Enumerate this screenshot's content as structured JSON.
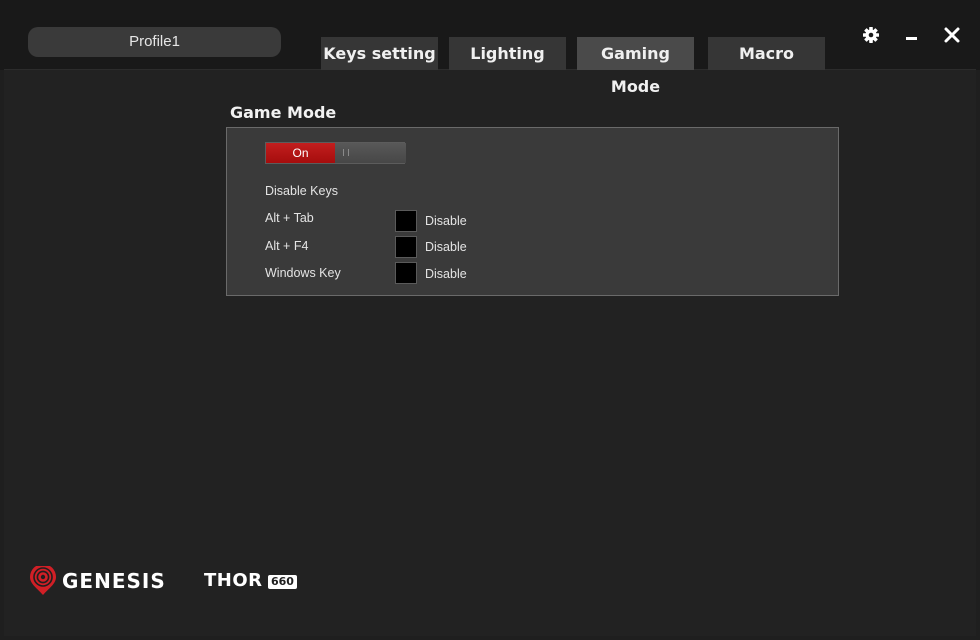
{
  "header": {
    "profile_label": "Profile1",
    "tabs": [
      {
        "label": "Keys setting",
        "active": false
      },
      {
        "label": "Lighting",
        "active": false
      },
      {
        "label": "Gaming Mode",
        "active": true
      },
      {
        "label": "Macro",
        "active": false
      }
    ],
    "window_icons": [
      "gear-icon",
      "minimize-icon",
      "close-icon"
    ]
  },
  "game_mode": {
    "title": "Game Mode",
    "toggle": {
      "on_label": "On",
      "state": "on"
    },
    "disable_keys_label": "Disable Keys",
    "keys": [
      {
        "name": "Alt + Tab",
        "option": "Disable",
        "checked": false
      },
      {
        "name": "Alt + F4",
        "option": "Disable",
        "checked": false
      },
      {
        "name": "Windows Key",
        "option": "Disable",
        "checked": false
      }
    ]
  },
  "brand": {
    "name": "GENESIS",
    "product": "THOR",
    "model": "660"
  },
  "colors": {
    "accent": "#c21e1e",
    "background": "#1f1f1f",
    "panel": "#3a3a3a"
  }
}
